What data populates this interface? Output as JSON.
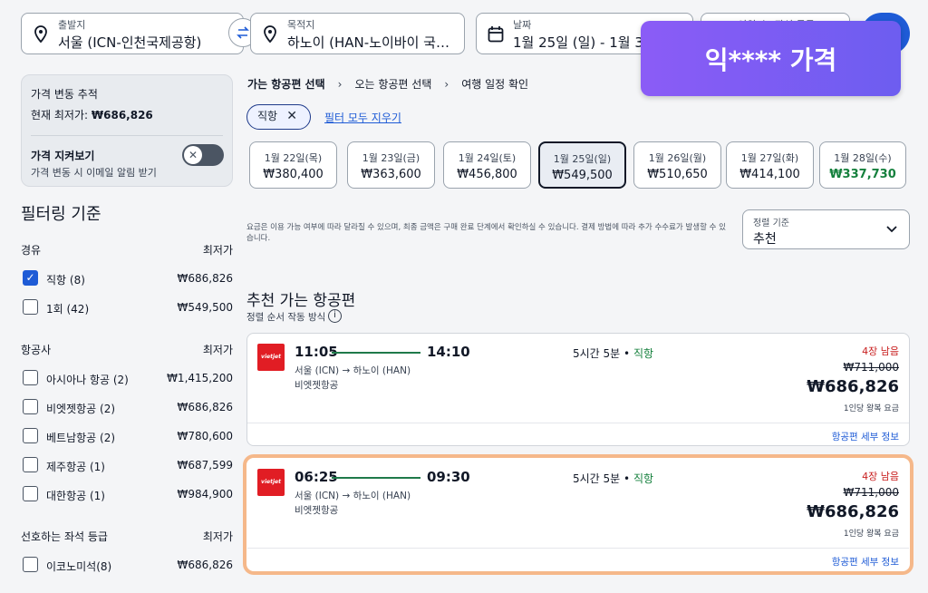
{
  "search": {
    "origin_label": "출발지",
    "origin_value": "서울 (ICN-인천국제공항)",
    "dest_label": "목적지",
    "dest_value": "하노이 (HAN-노이바이 국제...",
    "date_label": "날짜",
    "date_value": "1월 25일 (일) - 1월 31일",
    "travelers_label": "인원 수, 좌석 등급"
  },
  "banner": {
    "text": "익**** 가격"
  },
  "tracker": {
    "title": "가격 변동 추적",
    "lowest_prefix": "현재 최저가:",
    "lowest_value": "₩686,826",
    "watch_title": "가격 지켜보기",
    "watch_desc": "가격 변동 시 이메일 알림 받기"
  },
  "filters": {
    "title": "필터링 기준",
    "stops": {
      "head": "경유",
      "head_right": "최저가",
      "items": [
        {
          "label": "직항 (8)",
          "price": "₩686,826",
          "checked": true
        },
        {
          "label": "1회 (42)",
          "price": "₩549,500",
          "checked": false
        }
      ]
    },
    "airlines": {
      "head": "항공사",
      "head_right": "최저가",
      "items": [
        {
          "label": "아시아나 항공 (2)",
          "price": "₩1,415,200"
        },
        {
          "label": "비엣젯항공 (2)",
          "price": "₩686,826"
        },
        {
          "label": "베트남항공 (2)",
          "price": "₩780,600"
        },
        {
          "label": "제주항공 (1)",
          "price": "₩687,599"
        },
        {
          "label": "대한항공 (1)",
          "price": "₩984,900"
        }
      ]
    },
    "seat_class": {
      "head": "선호하는 좌석 등급",
      "head_right": "최저가",
      "items": [
        {
          "label": "이코노미석(8)",
          "price": "₩686,826"
        }
      ]
    }
  },
  "breadcrumb": {
    "step1": "가는 항공편 선택",
    "step2": "오는 항공편 선택",
    "step3": "여행 일정 확인"
  },
  "chip": {
    "label": "직항",
    "close": "✕"
  },
  "clear_all": "필터 모두 지우기",
  "dates": [
    {
      "day": "1월 22일(목)",
      "price": "₩380,400"
    },
    {
      "day": "1월 23일(금)",
      "price": "₩363,600"
    },
    {
      "day": "1월 24일(토)",
      "price": "₩456,800"
    },
    {
      "day": "1월 25일(일)",
      "price": "₩549,500"
    },
    {
      "day": "1월 26일(월)",
      "price": "₩510,650"
    },
    {
      "day": "1월 27일(화)",
      "price": "₩414,100"
    },
    {
      "day": "1월 28일(수)",
      "price": "₩337,730"
    }
  ],
  "notice": "요금은 이용 가능 여부에 따라 달라질 수 있으며, 최종 금액은 구매 완료 단계에서 확인하실 수 있습니다. 결제 방법에 따라 추가 수수료가 발생할 수 있습니다.",
  "sort": {
    "label": "정렬 기준",
    "value": "추천"
  },
  "recommended": {
    "title": "추천 가는 항공편",
    "sub": "정렬 순서 작동 방식",
    "info_icon": "i"
  },
  "flights": [
    {
      "logo": "vietjet",
      "dep": "11:05",
      "arr": "14:10",
      "route": "서울 (ICN) → 하노이 (HAN)",
      "airline": "비엣젯항공",
      "duration": "5시간 5분",
      "bullet": "•",
      "nonstop": "직항",
      "seats": "4장 남음",
      "orig_price": "₩711,000",
      "price": "₩686,826",
      "per": "1인당 왕복 요금",
      "detail": "항공편 세부 정보"
    },
    {
      "logo": "vietjet",
      "dep": "06:25",
      "arr": "09:30",
      "route": "서울 (ICN) → 하노이 (HAN)",
      "airline": "비엣젯항공",
      "duration": "5시간 5분",
      "bullet": "•",
      "nonstop": "직항",
      "seats": "4장 남음",
      "orig_price": "₩711,000",
      "price": "₩686,826",
      "per": "1인당 왕복 요금",
      "detail": "항공편 세부 정보"
    }
  ],
  "colors": {
    "accent": "#1e5bd6",
    "green": "#15803d",
    "red": "#c81e1e",
    "banner": "#7c5cf4",
    "highlight": "#f5b88a"
  }
}
